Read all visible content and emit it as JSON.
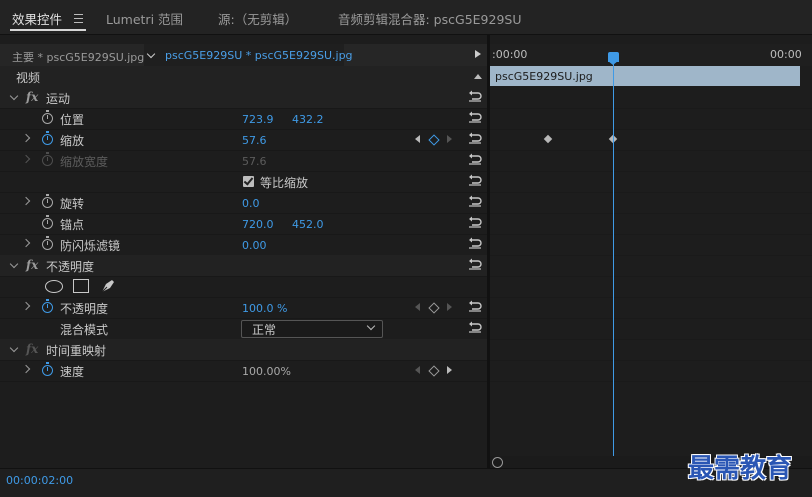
{
  "tabs": {
    "effect_controls": "效果控件",
    "lumetri": "Lumetri 范围",
    "source": "源:（无剪辑）",
    "audio_mixer": "音频剪辑混合器: pscG5E929SU"
  },
  "subtabs": {
    "master": "主要 * pscG5E929SU.jpg",
    "clip": "pscG5E929SU * pscG5E929SU.jpg"
  },
  "timeline": {
    "time_start": ":00:00",
    "time_end": "00:00",
    "clip_name": "pscG5E929SU.jpg"
  },
  "panel": {
    "video": "视频",
    "motion": {
      "title": "运动",
      "position": {
        "label": "位置",
        "x": "723.9",
        "y": "432.2"
      },
      "scale": {
        "label": "缩放",
        "value": "57.6"
      },
      "scale_width": {
        "label": "缩放宽度",
        "value": "57.6"
      },
      "uniform_scale": "等比缩放",
      "rotation": {
        "label": "旋转",
        "value": "0.0"
      },
      "anchor": {
        "label": "锚点",
        "x": "720.0",
        "y": "452.0"
      },
      "flicker": {
        "label": "防闪烁滤镜",
        "value": "0.00"
      }
    },
    "opacity": {
      "title": "不透明度",
      "opacity": {
        "label": "不透明度",
        "value": "100.0 %"
      },
      "blend": {
        "label": "混合模式",
        "value": "正常"
      }
    },
    "time_remap": {
      "title": "时间重映射",
      "speed": {
        "label": "速度",
        "value": "100.00%"
      }
    }
  },
  "status": {
    "time": "00:00:02:00"
  },
  "watermark": "最需教育"
}
